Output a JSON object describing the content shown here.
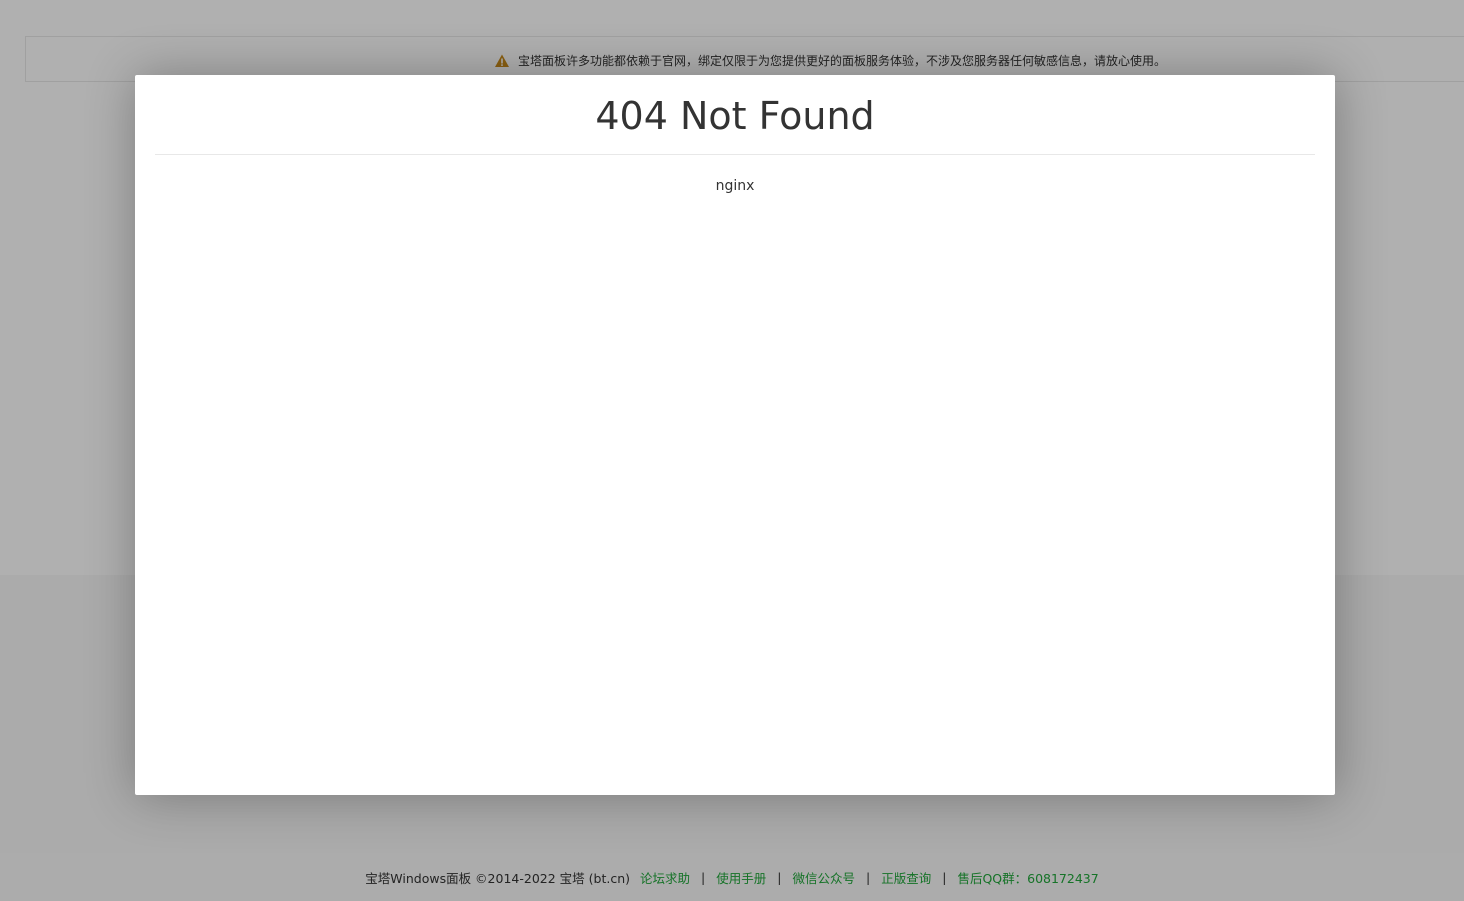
{
  "notice": {
    "icon": "warning-icon",
    "icon_color": "#c88a1b",
    "text": "宝塔面板许多功能都依赖于官网，绑定仅限于为您提供更好的面板服务体验，不涉及您服务器任何敏感信息，请放心使用。"
  },
  "modal": {
    "title": "404 Not Found",
    "server": "nginx"
  },
  "footer": {
    "copyright": "宝塔Windows面板 ©2014-2022 宝塔 (bt.cn)",
    "separator": "|",
    "links": [
      {
        "label": "论坛求助"
      },
      {
        "label": "使用手册"
      },
      {
        "label": "微信公众号"
      },
      {
        "label": "正版查询"
      },
      {
        "label": "售后QQ群：608172437"
      }
    ],
    "link_color": "#20a53a"
  }
}
